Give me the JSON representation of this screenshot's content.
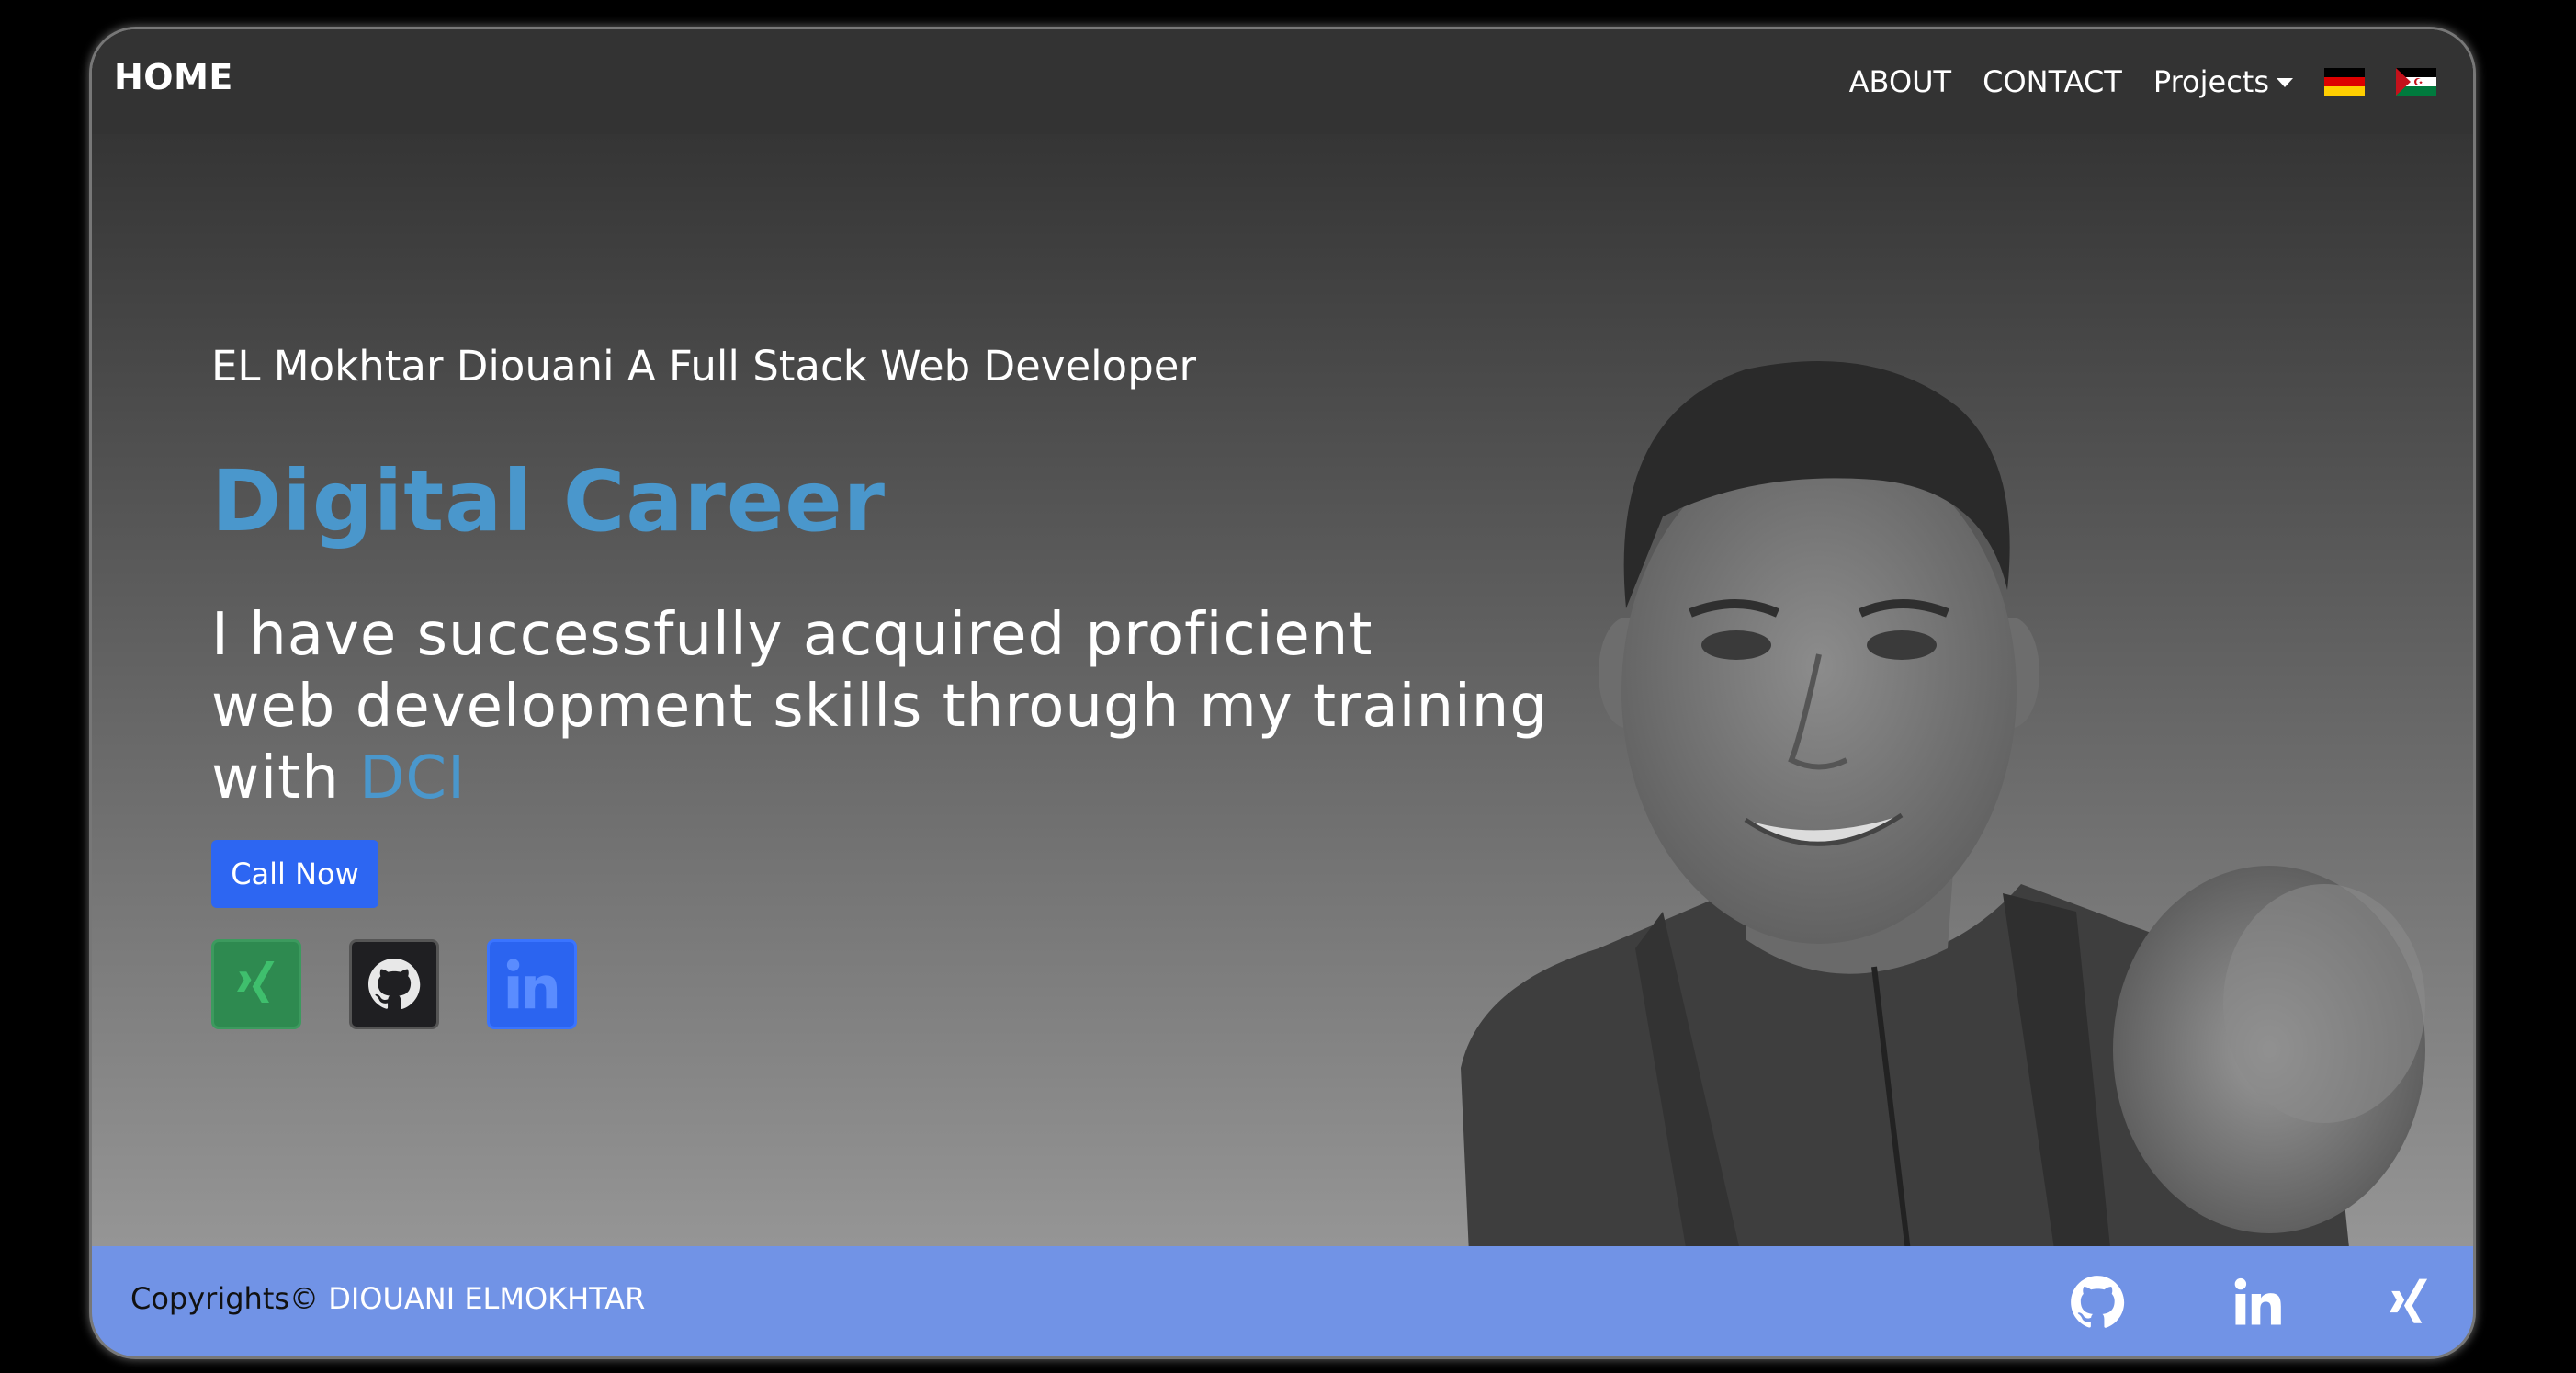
{
  "navbar": {
    "brand": "HOME",
    "links": {
      "about": "ABOUT",
      "contact": "CONTACT",
      "projects": "Projects"
    },
    "languages": [
      "german-flag-icon",
      "sahrawi-flag-icon"
    ]
  },
  "hero": {
    "subtitle": "EL Mokhtar Diouani A Full Stack Web Developer",
    "headline": "Digital Career",
    "lead_line1": "I have successfully acquired proficient",
    "lead_line2": "web development skills through my training",
    "lead_line3_prefix": "with ",
    "lead_accent": "DCI",
    "cta_label": "Call Now",
    "social": [
      "xing-icon",
      "github-icon",
      "linkedin-icon"
    ]
  },
  "footer": {
    "copyright_prefix": "Copyrights© ",
    "copyright_owner": "DIOUANI ELMOKHTAR",
    "icons": [
      "github-icon",
      "linkedin-icon",
      "xing-icon"
    ]
  },
  "colors": {
    "accent": "#4a97cc",
    "button": "#2d66f2",
    "footer": "#7193e6",
    "navbar": "#333333",
    "xing": "#2e8a50",
    "linkedin": "#2b64f0"
  }
}
